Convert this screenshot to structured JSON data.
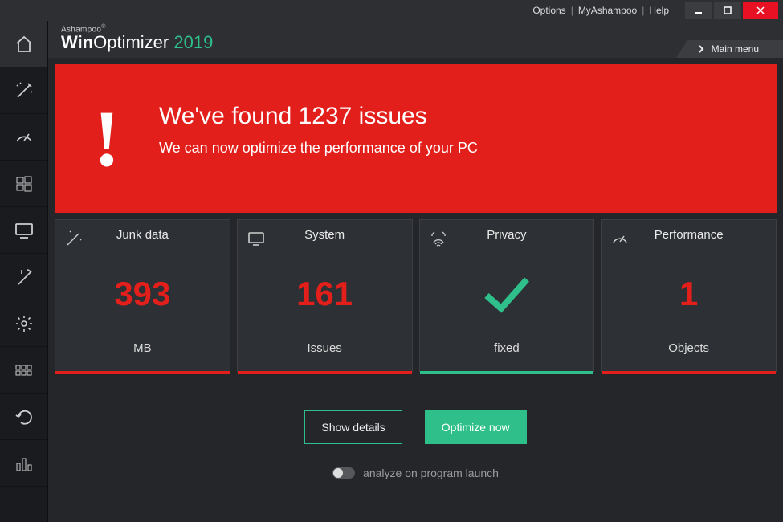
{
  "titlebar": {
    "options": "Options",
    "myashampoo": "MyAshampoo",
    "help": "Help"
  },
  "brand": {
    "company": "Ashampoo",
    "product_prefix": "Win",
    "product_suffix": "Optimizer",
    "year": "2019"
  },
  "mainmenu": {
    "label": "Main menu"
  },
  "hero": {
    "headline": "We've found 1237 issues",
    "subline": "We can now optimize the performance of your PC"
  },
  "cards": {
    "junk": {
      "title": "Junk data",
      "value": "393",
      "unit": "MB"
    },
    "system": {
      "title": "System",
      "value": "161",
      "unit": "Issues"
    },
    "privacy": {
      "title": "Privacy",
      "unit": "fixed"
    },
    "perf": {
      "title": "Performance",
      "value": "1",
      "unit": "Objects"
    }
  },
  "actions": {
    "details": "Show details",
    "optimize": "Optimize now"
  },
  "toggle": {
    "label": "analyze on program launch"
  }
}
